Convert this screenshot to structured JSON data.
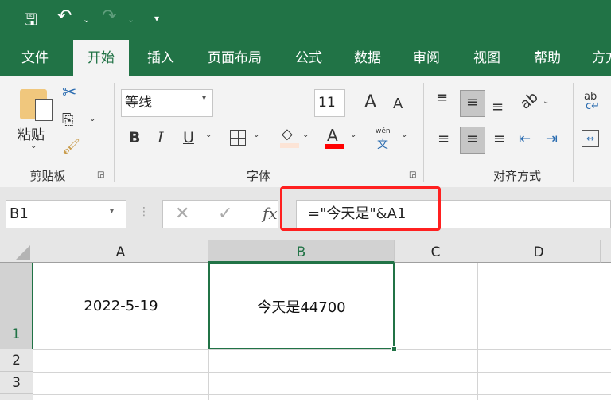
{
  "quick_access": {
    "save_icon": "save-icon",
    "undo_icon": "undo-icon",
    "redo_icon": "redo-icon",
    "customize_icon": "customize-icon"
  },
  "tabs": [
    {
      "label": "文件"
    },
    {
      "label": "开始",
      "active": true
    },
    {
      "label": "插入"
    },
    {
      "label": "页面布局"
    },
    {
      "label": "公式"
    },
    {
      "label": "数据"
    },
    {
      "label": "审阅"
    },
    {
      "label": "视图"
    },
    {
      "label": "帮助"
    },
    {
      "label": "方方"
    }
  ],
  "ribbon": {
    "clipboard": {
      "paste_label": "粘贴",
      "group_label": "剪贴板"
    },
    "font": {
      "font_name": "等线",
      "font_size": "11",
      "bold": "B",
      "italic": "I",
      "underline": "U",
      "font_color_glyph": "A",
      "phonetic_top": "wén",
      "phonetic_bottom": "文",
      "group_label": "字体",
      "font_color": "#ff0000",
      "fill_color": "#fce4d6"
    },
    "alignment": {
      "group_label": "对齐方式",
      "wrap_top": "ab",
      "wrap_bottom": "c↵"
    }
  },
  "formula_bar": {
    "name_box": "B1",
    "fx_label": "fx",
    "formula": "=\"今天是\"&A1",
    "highlight_color": "#ff2020"
  },
  "grid": {
    "columns": [
      "A",
      "B",
      "C",
      "D"
    ],
    "rows": [
      "1",
      "2",
      "3"
    ],
    "cells": {
      "A1": "2022-5-19",
      "B1": "今天是44700"
    },
    "selected": "B1",
    "accent": "#217346"
  }
}
